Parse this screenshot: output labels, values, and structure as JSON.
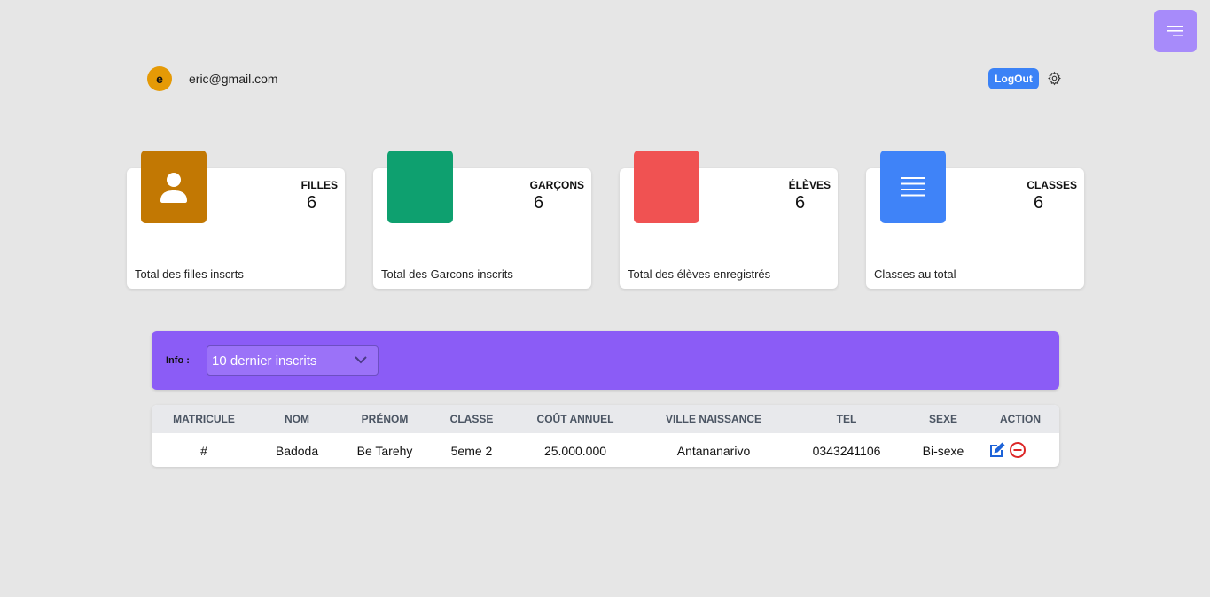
{
  "header": {
    "user_initial": "e",
    "user_email": "eric@gmail.com",
    "logout_label": "LogOut"
  },
  "stats": [
    {
      "title": "FILLES",
      "value": "6",
      "description": "Total des filles inscrts",
      "color": "#c27803",
      "icon": "user-icon"
    },
    {
      "title": "GARÇONS",
      "value": "6",
      "description": "Total des Garcons inscrits",
      "color": "#0ea06f",
      "icon": "blank"
    },
    {
      "title": "ÉLÈVES",
      "value": "6",
      "description": "Total des élèves enregistrés",
      "color": "#f05252",
      "icon": "blank"
    },
    {
      "title": "CLASSES",
      "value": "6",
      "description": "Classes au total",
      "color": "#3f83f8",
      "icon": "list-icon"
    }
  ],
  "info": {
    "label": "Info :",
    "selected_option": "10 dernier inscrits"
  },
  "table": {
    "columns": [
      "MATRICULE",
      "NOM",
      "PRÉNOM",
      "CLASSE",
      "COÛT ANNUEL",
      "VILLE NAISSANCE",
      "TEL",
      "SEXE",
      "ACTION"
    ],
    "rows": [
      {
        "matricule": "#",
        "nom": "Badoda",
        "prenom": "Be Tarehy",
        "classe": "5eme 2",
        "cout": "25.000.000",
        "ville": "Antananarivo",
        "tel": "0343241106",
        "sexe": "Bi-sexe"
      }
    ]
  },
  "colors": {
    "background": "#e6e6e6",
    "accent_purple": "#8b5cf6",
    "menu_button": "#a78bfa",
    "logout_blue": "#3b82f6",
    "edit_icon": "#1d63d8",
    "delete_icon": "#dc2626"
  }
}
